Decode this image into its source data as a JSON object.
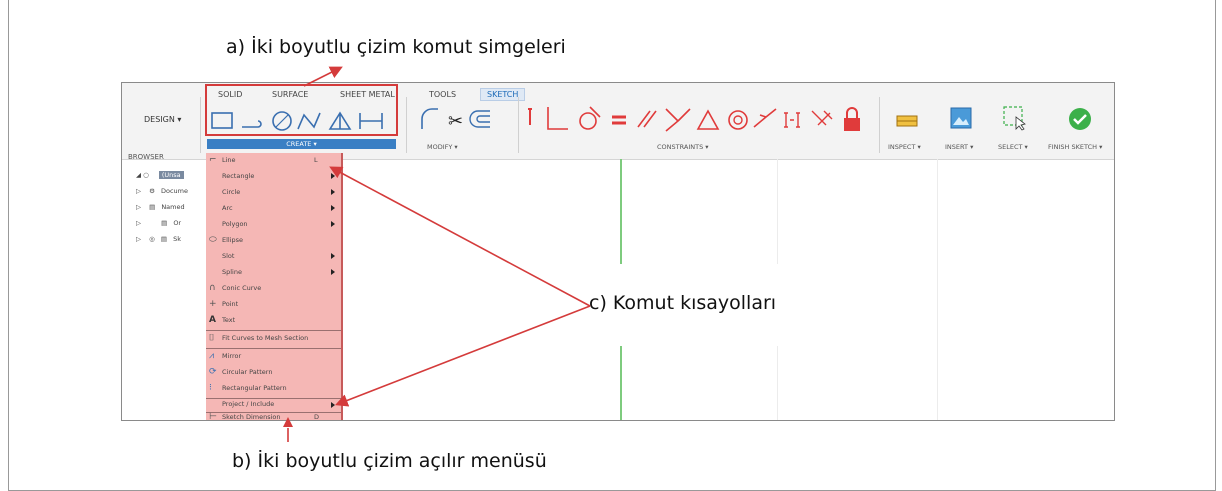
{
  "captions": {
    "a": "a) İki boyutlu çizim komut simgeleri",
    "b": "b) İki boyutlu çizim açılır menüsü",
    "c": "c) Komut kısayolları"
  },
  "toolbar": {
    "tabs": [
      "SOLID",
      "SURFACE",
      "SHEET METAL",
      "TOOLS",
      "SKETCH"
    ],
    "active_tab": "SKETCH",
    "workspace": "DESIGN ▾",
    "groups": {
      "create": "CREATE ▾",
      "modify": "MODIFY ▾",
      "constraints": "CONSTRAINTS ▾",
      "inspect": "INSPECT ▾",
      "insert": "INSERT ▾",
      "select": "SELECT ▾",
      "finish": "FINISH SKETCH ▾"
    }
  },
  "browser": {
    "title": "BROWSER",
    "items": [
      "(Unsa",
      "Docume",
      "Named",
      "Or",
      "Sk"
    ]
  },
  "create_menu": {
    "items": [
      {
        "label": "Line",
        "shortcut": "L",
        "submenu": false,
        "icon": "line-icon"
      },
      {
        "label": "Rectangle",
        "shortcut": "",
        "submenu": true,
        "icon": ""
      },
      {
        "label": "Circle",
        "shortcut": "",
        "submenu": true,
        "icon": ""
      },
      {
        "label": "Arc",
        "shortcut": "",
        "submenu": true,
        "icon": ""
      },
      {
        "label": "Polygon",
        "shortcut": "",
        "submenu": true,
        "icon": ""
      },
      {
        "label": "Ellipse",
        "shortcut": "",
        "submenu": false,
        "icon": "ellipse-icon"
      },
      {
        "label": "Slot",
        "shortcut": "",
        "submenu": true,
        "icon": ""
      },
      {
        "label": "Spline",
        "shortcut": "",
        "submenu": true,
        "icon": ""
      },
      {
        "label": "Conic Curve",
        "shortcut": "",
        "submenu": false,
        "icon": "conic-curve-icon"
      },
      {
        "label": "Point",
        "shortcut": "",
        "submenu": false,
        "icon": "point-icon"
      },
      {
        "label": "Text",
        "shortcut": "",
        "submenu": false,
        "icon": "text-icon"
      },
      {
        "label": "Fit Curves to Mesh Section",
        "shortcut": "",
        "submenu": false,
        "icon": "fit-curves-icon"
      },
      {
        "label": "Mirror",
        "shortcut": "",
        "submenu": false,
        "icon": "mirror-icon"
      },
      {
        "label": "Circular Pattern",
        "shortcut": "",
        "submenu": false,
        "icon": "circular-pattern-icon"
      },
      {
        "label": "Rectangular Pattern",
        "shortcut": "",
        "submenu": false,
        "icon": "rectangular-pattern-icon"
      },
      {
        "label": "Project / Include",
        "shortcut": "",
        "submenu": true,
        "icon": ""
      },
      {
        "label": "Sketch Dimension",
        "shortcut": "D",
        "submenu": false,
        "icon": "sketch-dimension-icon"
      }
    ]
  },
  "colors": {
    "highlight": "#f5b7b5",
    "callout_red": "#d43b3b",
    "create_bar": "#3a7fc4",
    "finish_green": "#3cb04a",
    "tool_red": "#e03b3b"
  }
}
